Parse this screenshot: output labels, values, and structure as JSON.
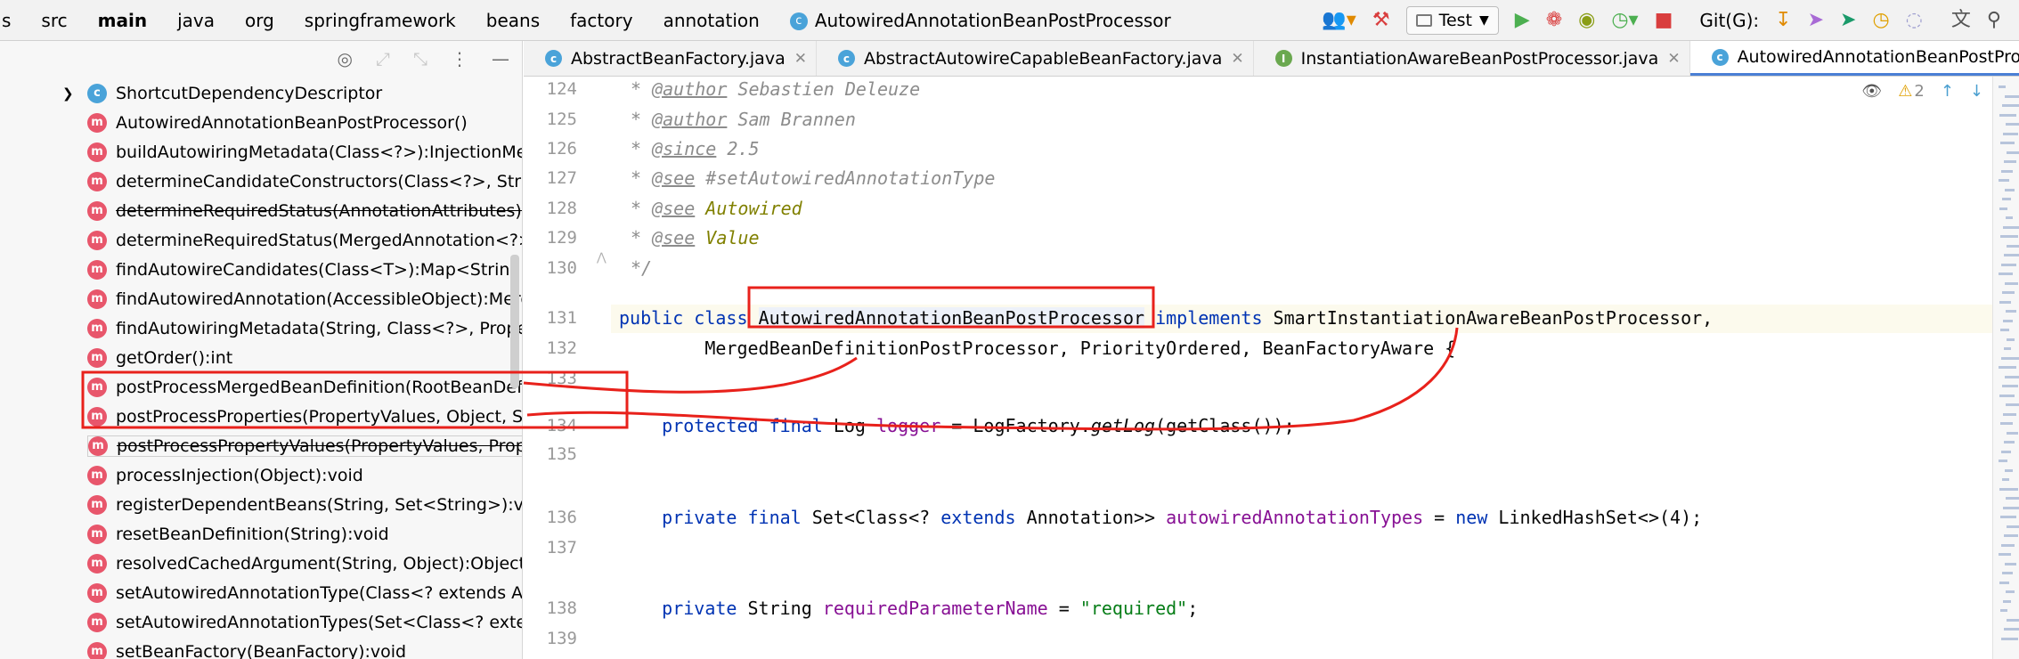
{
  "breadcrumb": {
    "items": [
      "s",
      "src",
      "main",
      "java",
      "org",
      "springframework",
      "beans",
      "factory",
      "annotation"
    ],
    "current": "AutowiredAnnotationBeanPostProcessor"
  },
  "toolbar": {
    "run_config": "Test",
    "git_label": "Git(G):"
  },
  "structure": {
    "items": [
      {
        "kind": "c",
        "label": "ShortcutDependencyDescriptor",
        "expandable": true,
        "deprecated": false
      },
      {
        "kind": "m",
        "label": "AutowiredAnnotationBeanPostProcessor()",
        "deprecated": false
      },
      {
        "kind": "m",
        "label": "buildAutowiringMetadata(Class<?>):InjectionMetada",
        "deprecated": false
      },
      {
        "kind": "m",
        "label": "determineCandidateConstructors(Class<?>, String):Co",
        "deprecated": false
      },
      {
        "kind": "m",
        "label": "determineRequiredStatus(AnnotationAttributes):bool",
        "deprecated": true
      },
      {
        "kind": "m",
        "label": "determineRequiredStatus(MergedAnnotation<?>):bo",
        "deprecated": false
      },
      {
        "kind": "m",
        "label": "findAutowireCandidates(Class<T>):Map<String, T>",
        "deprecated": false
      },
      {
        "kind": "m",
        "label": "findAutowiredAnnotation(AccessibleObject):MergedA",
        "deprecated": false
      },
      {
        "kind": "m",
        "label": "findAutowiringMetadata(String, Class<?>, PropertyVa",
        "deprecated": false
      },
      {
        "kind": "m",
        "label": "getOrder():int",
        "deprecated": false
      },
      {
        "kind": "m",
        "label": "postProcessMergedBeanDefinition(RootBeanDefinitio",
        "deprecated": false
      },
      {
        "kind": "m",
        "label": "postProcessProperties(PropertyValues, Object, String)",
        "deprecated": false
      },
      {
        "kind": "m",
        "label": "postProcessPropertyValues(PropertyValues, PropertyDescriptor[], Object, String):PropertyValues",
        "deprecated": true,
        "tooltip": true
      },
      {
        "kind": "m",
        "label": "processInjection(Object):void",
        "deprecated": false
      },
      {
        "kind": "m",
        "label": "registerDependentBeans(String, Set<String>):void",
        "deprecated": false
      },
      {
        "kind": "m",
        "label": "resetBeanDefinition(String):void",
        "deprecated": false
      },
      {
        "kind": "m",
        "label": "resolvedCachedArgument(String, Object):Object",
        "deprecated": false
      },
      {
        "kind": "m",
        "label": "setAutowiredAnnotationType(Class<? extends Annota",
        "deprecated": false
      },
      {
        "kind": "m",
        "label": "setAutowiredAnnotationTypes(Set<Class<? extends A",
        "deprecated": false
      },
      {
        "kind": "m",
        "label": "setBeanFactory(BeanFactory):void",
        "deprecated": false
      }
    ]
  },
  "tabs": [
    {
      "label": "AbstractBeanFactory.java",
      "icon": "c",
      "active": false
    },
    {
      "label": "AbstractAutowireCapableBeanFactory.java",
      "icon": "c",
      "active": false
    },
    {
      "label": "InstantiationAwareBeanPostProcessor.java",
      "icon": "i",
      "active": false
    },
    {
      "label": "AutowiredAnnotationBeanPostProcessor.java",
      "icon": "c",
      "active": true
    }
  ],
  "editor": {
    "warning_count": "2",
    "lines": [
      {
        "n": "124",
        "t": "<span class=\"cm\">* </span><span class=\"tag\">@author</span><span class=\"cm\"> Sebastien Deleuze</span>",
        "i": 1
      },
      {
        "n": "125",
        "t": "<span class=\"cm\">* </span><span class=\"tag\">@author</span><span class=\"cm\"> Sam Brannen</span>",
        "i": 1
      },
      {
        "n": "126",
        "t": "<span class=\"cm\">* </span><span class=\"tag\">@since</span><span class=\"cm\"> 2.5</span>",
        "i": 1
      },
      {
        "n": "127",
        "t": "<span class=\"cm\">* </span><span class=\"tag\">@see</span><span class=\"cm\"> #setAutowiredAnnotationType</span>",
        "i": 1
      },
      {
        "n": "128",
        "t": "<span class=\"cm\">* </span><span class=\"tag\">@see</span><span class=\"ref\"> Autowired</span>",
        "i": 1
      },
      {
        "n": "129",
        "t": "<span class=\"cm\">* </span><span class=\"tag\">@see</span><span class=\"ref\"> Value</span>",
        "i": 1
      },
      {
        "n": "130",
        "t": "<span class=\"cm\">*/</span>",
        "i": 1
      },
      {
        "n": "131",
        "t": "<span class=\"kw\">public class </span><span class=\"cls-hl\">AutowiredAnnotationBeanPostProcessor</span> <span class=\"kw\">implements</span> SmartInstantiationAwareBeanPostProcessor,",
        "i": 0
      },
      {
        "n": "132",
        "t": "        MergedBeanDefinitionPostProcessor, PriorityOrdered, BeanFactoryAware {",
        "i": 0
      },
      {
        "n": "133",
        "t": "",
        "i": 0
      },
      {
        "n": "134",
        "t": "    <span class=\"kw\">protected final </span>Log <span class=\"fld\">logger</span> = LogFactory.<i>getLog</i>(getClass());",
        "i": 0
      },
      {
        "n": "135",
        "t": "",
        "i": 0
      },
      {
        "n": "136",
        "t": "    <span class=\"kw\">private final </span>Set&lt;Class&lt;? <span class=\"kw\">extends</span> Annotation&gt;&gt; <span class=\"fld\">autowiredAnnotationTypes</span> = <span class=\"kw\">new</span> LinkedHashSet&lt;&gt;(4);",
        "i": 0
      },
      {
        "n": "137",
        "t": "",
        "i": 0
      },
      {
        "n": "138",
        "t": "    <span class=\"kw\">private </span>String <span class=\"fld\">requiredParameterName</span> = <span class=\"str\">\"required\"</span>;",
        "i": 0
      },
      {
        "n": "139",
        "t": "",
        "i": 0
      }
    ]
  }
}
